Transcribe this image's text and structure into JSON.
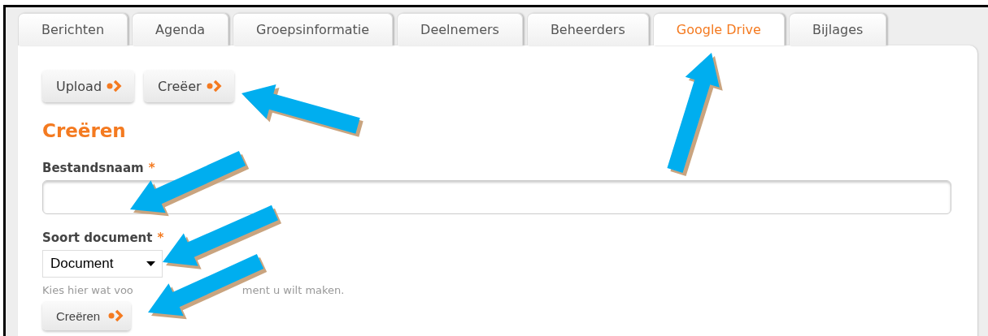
{
  "tabs": [
    {
      "label": "Berichten",
      "selected": false
    },
    {
      "label": "Agenda",
      "selected": false
    },
    {
      "label": "Groepsinformatie",
      "selected": false
    },
    {
      "label": "Deelnemers",
      "selected": false
    },
    {
      "label": "Beheerders",
      "selected": false
    },
    {
      "label": "Google Drive",
      "selected": true
    },
    {
      "label": "Bijlages",
      "selected": false
    }
  ],
  "actions": [
    {
      "label": "Upload"
    },
    {
      "label": "Creëer"
    }
  ],
  "heading": "Creëren",
  "fields": [
    {
      "kind": "text",
      "label": "Bestandsnaam",
      "required_mark": "*"
    },
    {
      "kind": "select",
      "label": "Soort document",
      "required_mark": "*",
      "value": "Document",
      "hint_parts": [
        "Kies hier wat voo",
        "ment u wilt maken."
      ]
    }
  ],
  "submit": {
    "label": "Creëren"
  }
}
